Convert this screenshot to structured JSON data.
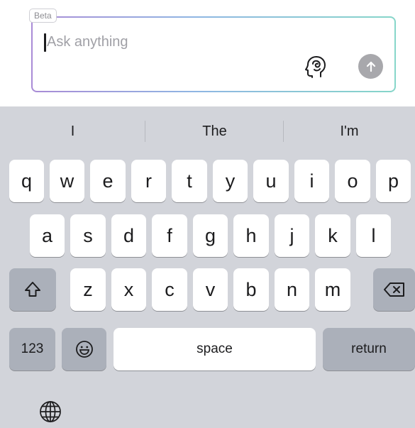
{
  "composer": {
    "badge": "Beta",
    "placeholder": "Ask anything",
    "value": "",
    "reasoning_icon": "brain-icon",
    "send_icon": "arrow-up-icon",
    "send_color": "#a8a8ac",
    "border_gradient": [
      "#a98bd6",
      "#8fb6e3",
      "#86d6c9"
    ]
  },
  "keyboard": {
    "predictions": [
      "I",
      "The",
      "I'm"
    ],
    "row1": [
      "q",
      "w",
      "e",
      "r",
      "t",
      "y",
      "u",
      "i",
      "o",
      "p"
    ],
    "row2": [
      "a",
      "s",
      "d",
      "f",
      "g",
      "h",
      "j",
      "k",
      "l"
    ],
    "row3": [
      "z",
      "x",
      "c",
      "v",
      "b",
      "n",
      "m"
    ],
    "shift_icon": "shift-icon",
    "delete_icon": "delete-icon",
    "numbers_label": "123",
    "emoji_icon": "emoji-icon",
    "space_label": "space",
    "return_label": "return",
    "globe_icon": "globe-icon",
    "background_color": "#d2d4da"
  }
}
